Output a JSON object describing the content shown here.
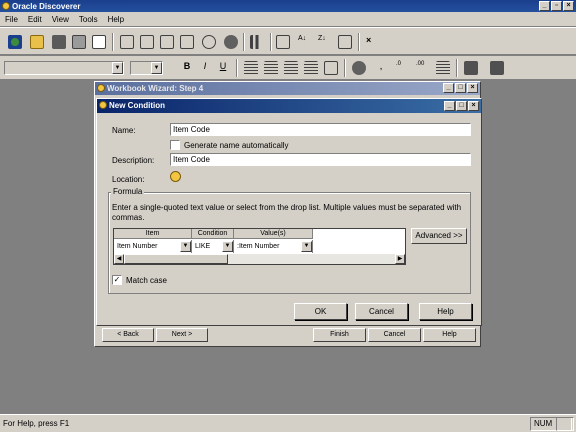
{
  "app": {
    "title": "Oracle Discoverer",
    "menu": [
      "File",
      "Edit",
      "View",
      "Tools",
      "Help"
    ]
  },
  "toolbar": {
    "style_combo_value": "",
    "size_combo_value": "",
    "bold_label": "B",
    "italic_label": "I",
    "underline_label": "U",
    "comma_label": ","
  },
  "wizard": {
    "title": "Workbook Wizard: Step 4",
    "back_label": "< Back",
    "next_label": "Next >",
    "finish_label": "Finish",
    "cancel_label": "Cancel",
    "help_label": "Help"
  },
  "dialog": {
    "title": "New Condition",
    "name_label": "Name:",
    "name_value": "Item Code",
    "auto_name_label": "Generate name automatically",
    "auto_name_checked": false,
    "description_label": "Description:",
    "description_value": "Item Code",
    "location_label": "Location:",
    "formula_label": "Formula",
    "formula_hint": "Enter a single-quoted text value or select from the drop list.  Multiple values must be separated with commas.",
    "grid": {
      "headers": [
        "Item",
        "Condition",
        "Value(s)"
      ],
      "row": {
        "item": "Item Number",
        "condition": "LIKE",
        "value": ":Item Number"
      }
    },
    "advanced_label": "Advanced >>",
    "match_case_label": "Match case",
    "match_case_checked": true,
    "ok_label": "OK",
    "cancel_label": "Cancel",
    "help_label": "Help"
  },
  "status": {
    "message": "For Help, press F1",
    "num": "NUM"
  }
}
